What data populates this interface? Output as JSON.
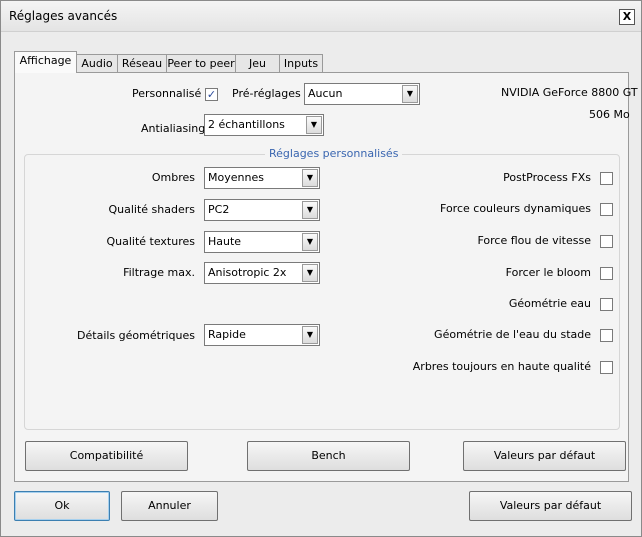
{
  "window": {
    "title": "Réglages avancés",
    "close_glyph": "X"
  },
  "tabs": [
    "Affichage",
    "Audio",
    "Réseau",
    "Peer to peer",
    "Jeu",
    "Inputs"
  ],
  "top": {
    "personnalise_label": "Personnalisé",
    "personnalise_checked": true,
    "check_glyph": "✓",
    "preset_label": "Pré-réglages",
    "preset_value": "Aucun",
    "antialiasing_label": "Antialiasing",
    "antialiasing_value": "2 échantillons",
    "gpu_name": "NVIDIA GeForce 8800 GT",
    "gpu_memory": "506 Mo"
  },
  "group": {
    "title": "Réglages personnalisés",
    "left": [
      {
        "label": "Ombres",
        "value": "Moyennes"
      },
      {
        "label": "Qualité shaders",
        "value": "PC2"
      },
      {
        "label": "Qualité textures",
        "value": "Haute"
      },
      {
        "label": "Filtrage max.",
        "value": "Anisotropic  2x"
      },
      {
        "label": "Détails géométriques",
        "value": "Rapide"
      }
    ],
    "right": [
      {
        "label": "PostProcess FXs",
        "checked": false
      },
      {
        "label": "Force couleurs dynamiques",
        "checked": false
      },
      {
        "label": "Force flou de vitesse",
        "checked": false
      },
      {
        "label": "Forcer le bloom",
        "checked": false
      },
      {
        "label": "Géométrie eau",
        "checked": false
      },
      {
        "label": "Géométrie de l'eau du stade",
        "checked": false
      },
      {
        "label": "Arbres toujours en haute qualité",
        "checked": false
      }
    ]
  },
  "panel_buttons": {
    "compat": "Compatibilité",
    "bench": "Bench",
    "defaults": "Valeurs par défaut"
  },
  "bottom_buttons": {
    "ok": "Ok",
    "cancel": "Annuler",
    "defaults": "Valeurs par défaut"
  },
  "icons": {
    "dropdown": "chevron-down-icon"
  },
  "dropdown_glyph": "▼"
}
